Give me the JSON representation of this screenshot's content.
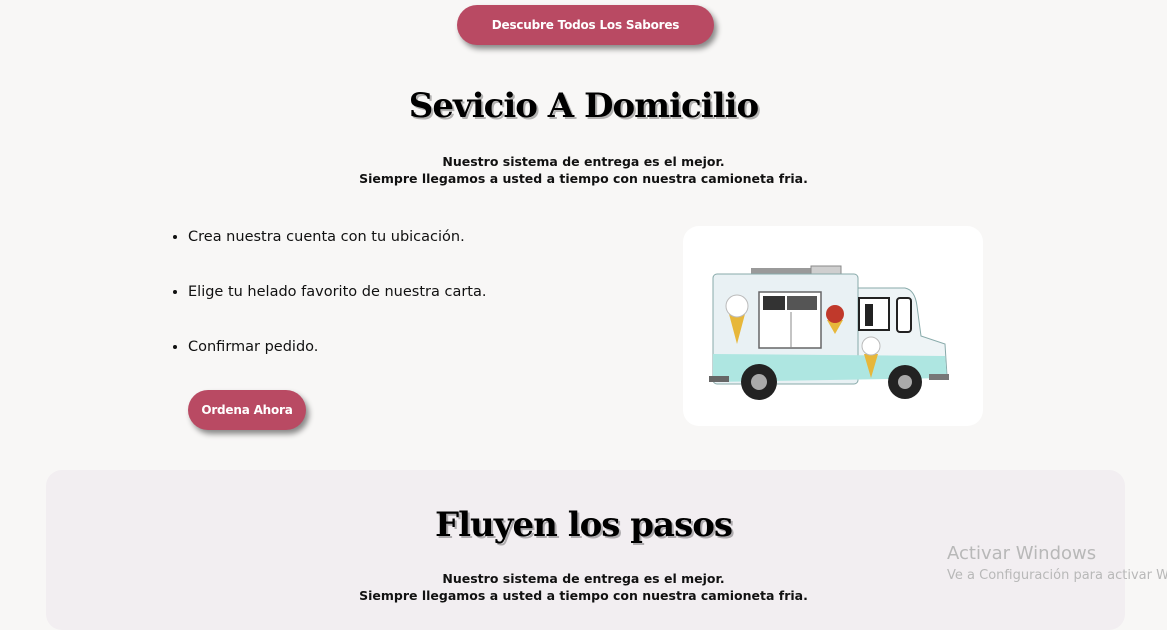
{
  "discover_button": "Descubre Todos Los Sabores",
  "service": {
    "title": "Sevicio A Domicilio",
    "subtitle_line1": "Nuestro sistema de entrega es el mejor.",
    "subtitle_line2": "Siempre llegamos a usted a tiempo con nuestra camioneta fria.",
    "steps": [
      "Crea nuestra cuenta con tu ubicación.",
      "Elige tu helado favorito de nuestra carta.",
      "Confirmar pedido."
    ],
    "order_button": "Ordena Ahora",
    "image_icon": "ice-cream-truck"
  },
  "flow": {
    "title": "Fluyen los pasos",
    "subtitle_line1": "Nuestro sistema de entrega es el mejor.",
    "subtitle_line2": "Siempre llegamos a usted a tiempo con nuestra camioneta fria."
  },
  "watermark": {
    "line1": "Activar Windows",
    "line2": "Ve a Configuración para activar W"
  },
  "colors": {
    "accent": "#b94a63",
    "background": "#f8f7f6",
    "panel": "#f2eef1"
  }
}
